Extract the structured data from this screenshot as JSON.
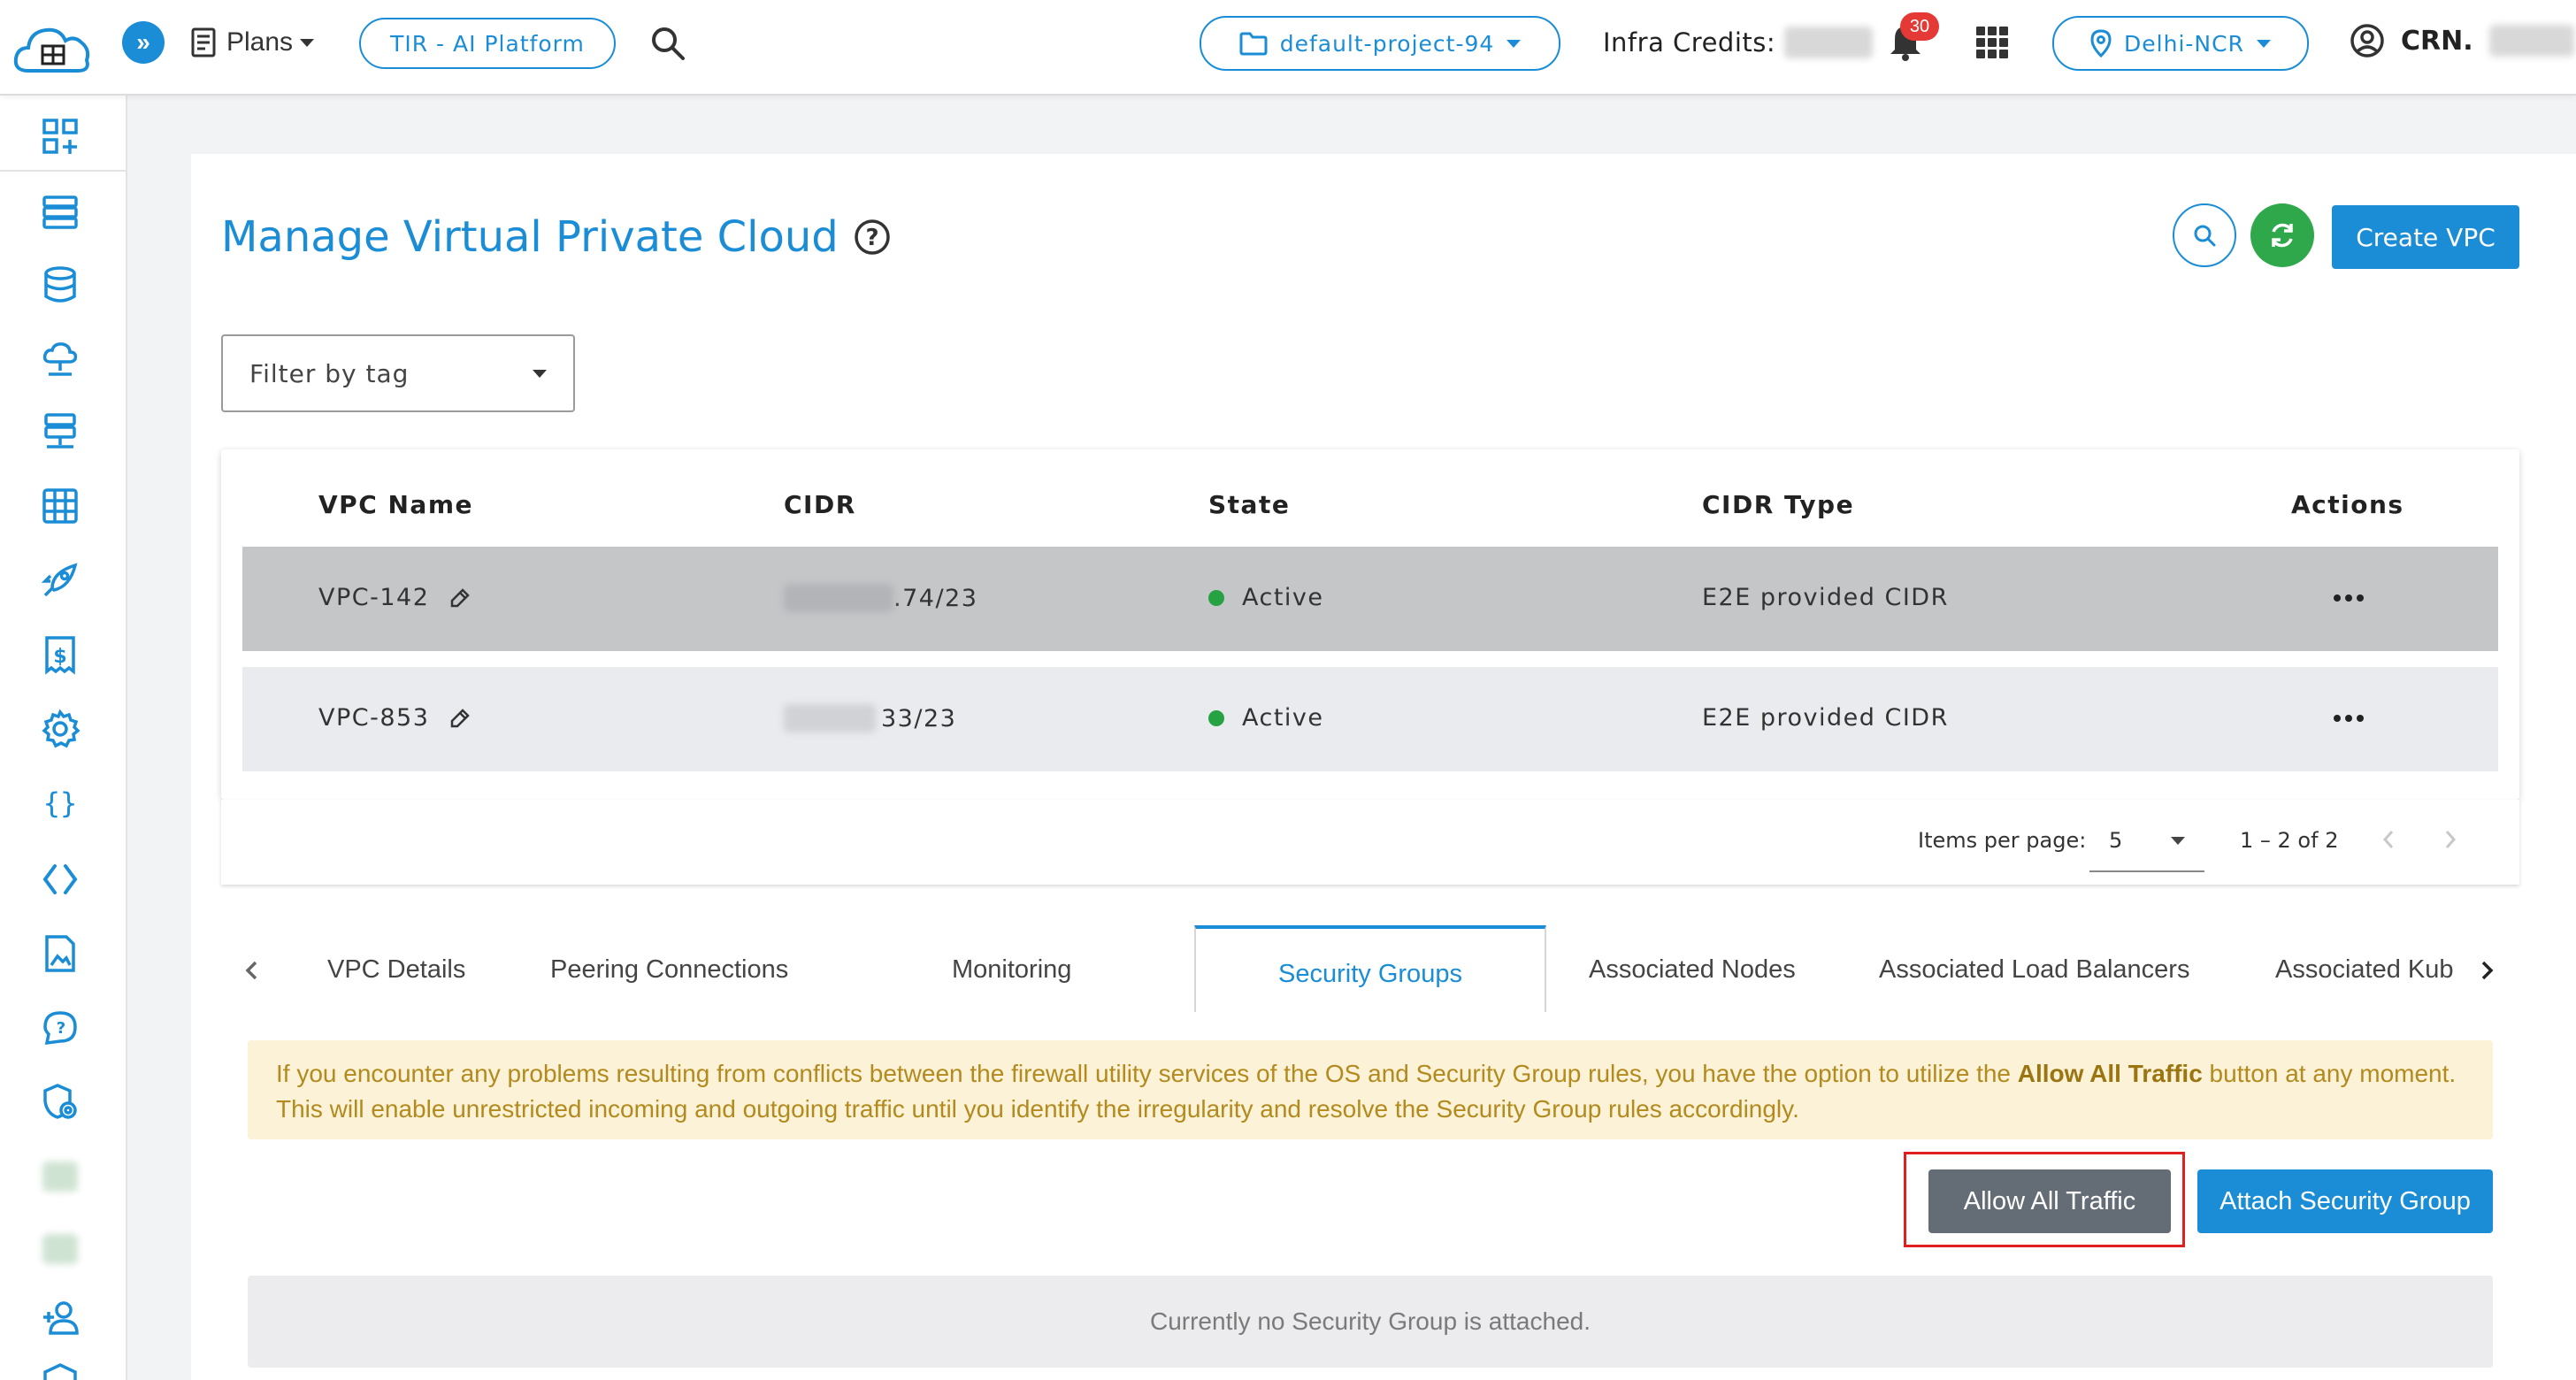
{
  "header": {
    "plans_label": "Plans",
    "platform_label": "TIR - AI Platform",
    "project_label": "default-project-94",
    "infra_credits_label": "Infra Credits:",
    "notification_count": "30",
    "region_label": "Delhi-NCR",
    "crn_label": "CRN."
  },
  "sidebar": {
    "icons": [
      "dashboard-add-icon",
      "server-stack-icon",
      "database-icon",
      "cloud-network-icon",
      "network-server-icon",
      "table-grid-icon",
      "rocket-icon",
      "billing-icon",
      "settings-gear-icon",
      "curly-braces-icon",
      "code-brackets-icon",
      "document-image-icon",
      "support-chat-icon",
      "shield-settings-icon",
      "add-user-icon"
    ]
  },
  "page": {
    "title": "Manage Virtual Private Cloud",
    "create_button": "Create VPC",
    "filter_placeholder": "Filter by tag"
  },
  "table": {
    "columns": [
      "VPC Name",
      "CIDR",
      "State",
      "CIDR Type",
      "Actions"
    ],
    "rows": [
      {
        "name": "VPC-142",
        "cidr_suffix": ".74/23",
        "state": "Active",
        "cidr_type": "E2E provided CIDR"
      },
      {
        "name": "VPC-853",
        "cidr_suffix": "33/23",
        "state": "Active",
        "cidr_type": "E2E provided CIDR"
      }
    ]
  },
  "paginator": {
    "items_per_page_label": "Items per page:",
    "page_size": "5",
    "range_label": "1 – 2 of 2"
  },
  "tabs": [
    "VPC Details",
    "Peering Connections",
    "Monitoring",
    "Security Groups",
    "Associated Nodes",
    "Associated Load Balancers",
    "Associated Kub"
  ],
  "active_tab": "Security Groups",
  "notice": {
    "text_before": "If you encounter any problems resulting from conflicts between the firewall utility services of the OS and Security Group rules, you have the option to utilize the ",
    "bold": "Allow All Traffic",
    "text_after": " button at any moment. This will enable unrestricted incoming and outgoing traffic until you identify the irregularity and resolve the Security Group rules accordingly."
  },
  "actions": {
    "allow_all": "Allow All Traffic",
    "attach": "Attach Security Group"
  },
  "empty_state": "Currently no Security Group is attached.",
  "colors": {
    "brand": "#1a8dd6",
    "active_dot": "#27a243",
    "refresh": "#2ea84a",
    "highlight": "#e02020"
  }
}
